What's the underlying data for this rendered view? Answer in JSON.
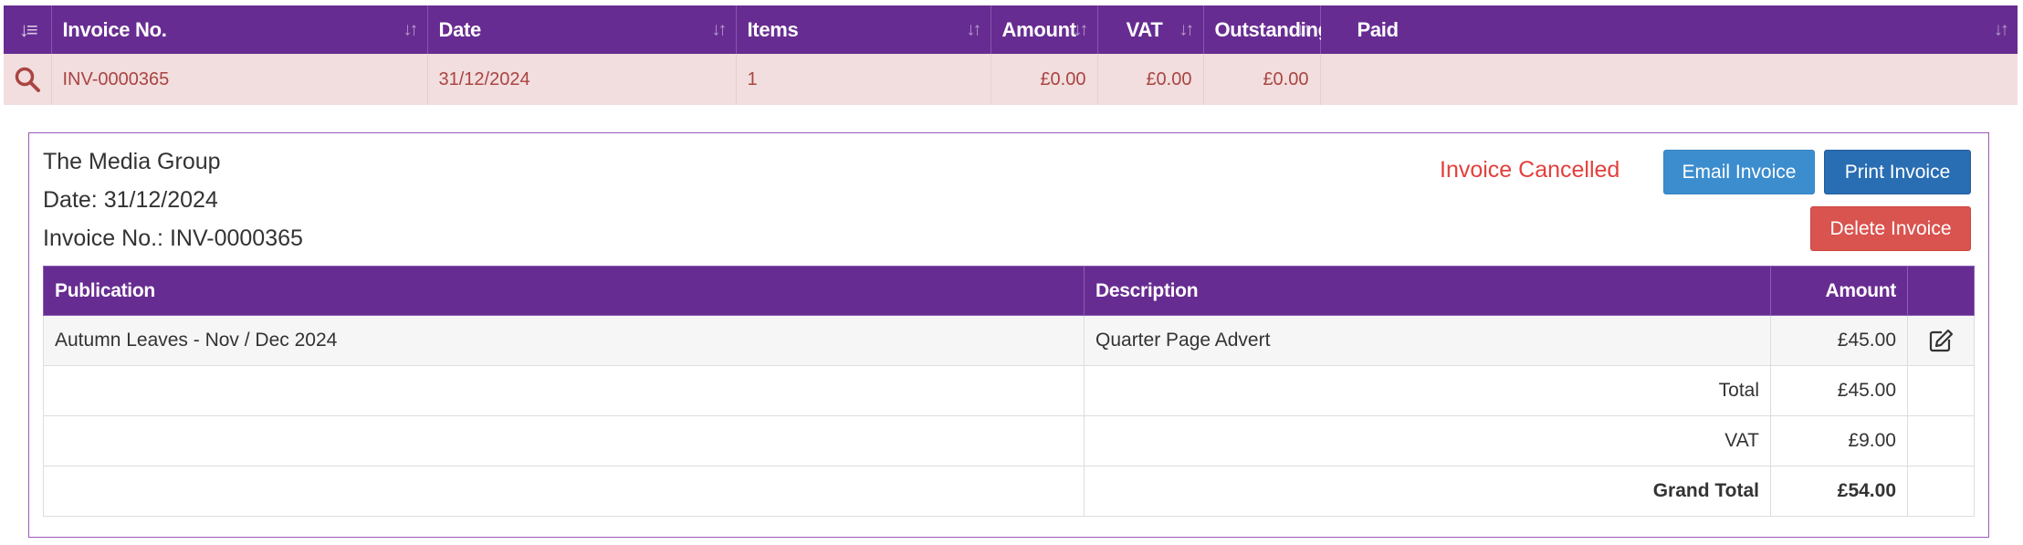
{
  "list": {
    "columns": [
      {
        "label": ""
      },
      {
        "label": "Invoice No."
      },
      {
        "label": "Date"
      },
      {
        "label": "Items"
      },
      {
        "label": "Amount"
      },
      {
        "label": "VAT"
      },
      {
        "label": "Outstanding"
      },
      {
        "label": "Paid"
      }
    ],
    "row": {
      "invoice_no": "INV-0000365",
      "date": "31/12/2024",
      "items": "1",
      "amount": "£0.00",
      "vat": "£0.00",
      "outstanding": "£0.00",
      "paid": ""
    },
    "header_color": "#672c91",
    "row_bg": "#f2dede",
    "row_text": "#a94442"
  },
  "detail": {
    "customer": "The Media Group",
    "date_line": "Date: 31/12/2024",
    "invoice_line": "Invoice No.: INV-0000365",
    "status": "Invoice Cancelled",
    "status_color": "#e2403c",
    "buttons": {
      "email": "Email Invoice",
      "print": "Print Invoice",
      "delete": "Delete Invoice"
    },
    "table": {
      "headers": {
        "publication": "Publication",
        "description": "Description",
        "amount": "Amount"
      },
      "rows": [
        {
          "publication": "Autumn Leaves - Nov / Dec 2024",
          "description": "Quarter Page Advert",
          "amount": "£45.00"
        }
      ],
      "totals": [
        {
          "label": "Total",
          "value": "£45.00"
        },
        {
          "label": "VAT",
          "value": "£9.00"
        },
        {
          "label": "Grand Total",
          "value": "£54.00"
        }
      ]
    }
  },
  "icons": {
    "sort": "sort-icon",
    "sort_active": "sort-desc-icon",
    "search": "search-icon",
    "edit": "edit-icon"
  }
}
